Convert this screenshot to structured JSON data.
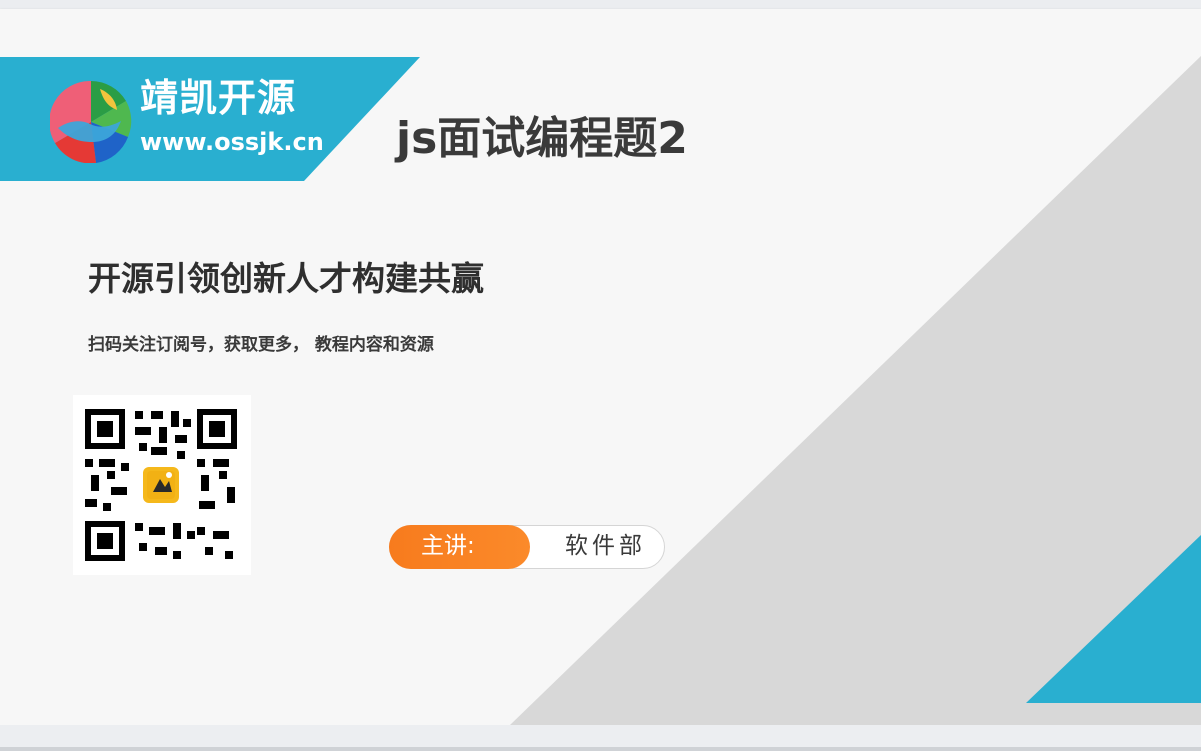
{
  "brand": {
    "name": "靖凯开源",
    "url": "www.ossjk.cn"
  },
  "title": "js面试编程题2",
  "slogan": "开源引领创新人才构建共赢",
  "subtitle": "扫码关注订阅号，获取更多，  教程内容和资源",
  "speaker": {
    "label": "主讲:",
    "name": "软件部"
  },
  "icons": {
    "logo": "multicolor-circle-logo-icon",
    "qr": "qr-code-icon"
  },
  "colors": {
    "primary": "#29afd0",
    "accent": "#f77b1d",
    "gray_shape": "#d6d6d6",
    "title_text": "#3a3a3a"
  }
}
